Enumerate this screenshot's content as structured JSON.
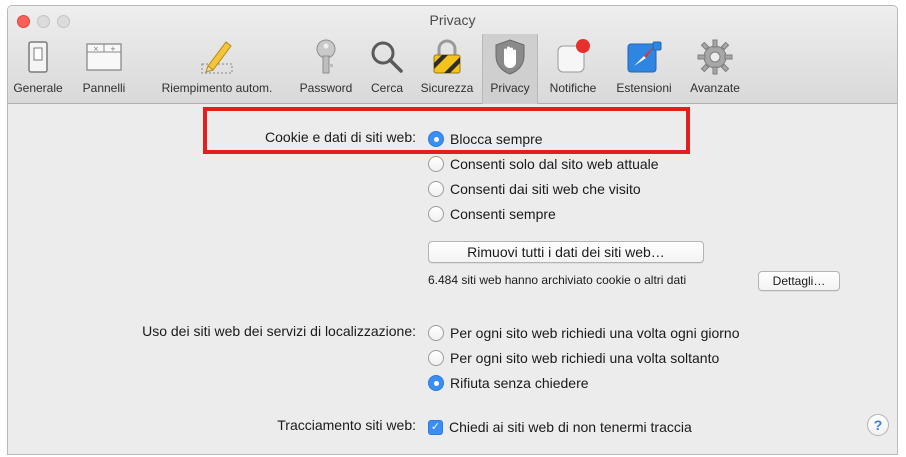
{
  "window": {
    "title": "Privacy"
  },
  "toolbar": {
    "items": [
      {
        "label": "Generale",
        "icon": "general-switch-icon"
      },
      {
        "label": "Pannelli",
        "icon": "tabs-icon"
      },
      {
        "label": "Riempimento autom.",
        "icon": "pencil-icon"
      },
      {
        "label": "Password",
        "icon": "key-icon"
      },
      {
        "label": "Cerca",
        "icon": "magnifier-icon"
      },
      {
        "label": "Sicurezza",
        "icon": "padlock-icon"
      },
      {
        "label": "Privacy",
        "icon": "hand-icon",
        "active": true
      },
      {
        "label": "Notifiche",
        "icon": "notification-badge-icon"
      },
      {
        "label": "Estensioni",
        "icon": "compass-icon"
      },
      {
        "label": "Avanzate",
        "icon": "gear-icon"
      }
    ]
  },
  "cookies": {
    "label": "Cookie e dati di siti web:",
    "options": [
      {
        "label": "Blocca sempre",
        "selected": true
      },
      {
        "label": "Consenti solo dal sito web attuale",
        "selected": false
      },
      {
        "label": "Consenti dai siti web che visito",
        "selected": false
      },
      {
        "label": "Consenti sempre",
        "selected": false
      }
    ],
    "remove_button": "Rimuovi tutti i dati dei siti web…",
    "stored_info": "6.484 siti web hanno archiviato cookie o altri dati",
    "details_button": "Dettagli…"
  },
  "location": {
    "label": "Uso dei siti web dei servizi di localizzazione:",
    "options": [
      {
        "label": "Per ogni sito web richiedi una volta ogni giorno",
        "selected": false
      },
      {
        "label": "Per ogni sito web richiedi una volta soltanto",
        "selected": false
      },
      {
        "label": "Rifiuta senza chiedere",
        "selected": true
      }
    ]
  },
  "tracking": {
    "label": "Tracciamento siti web:",
    "checkbox_label": "Chiedi ai siti web di non tenermi traccia",
    "checked": true
  },
  "help": {
    "label": "?"
  },
  "colors": {
    "accent": "#3a8ef6",
    "highlight": "#e41d1d",
    "close": "#fc5f57"
  }
}
